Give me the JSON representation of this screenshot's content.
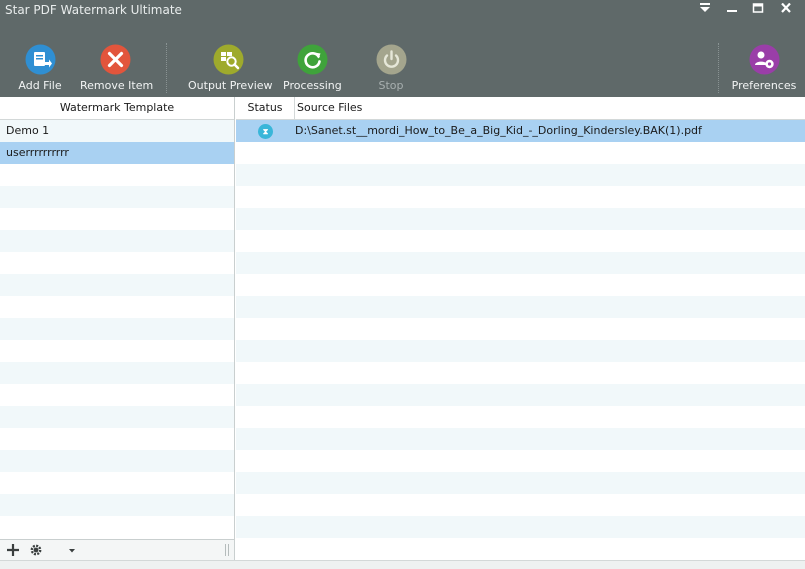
{
  "window": {
    "title": "Star PDF Watermark Ultimate"
  },
  "toolbar": {
    "add_file": "Add File",
    "remove_item": "Remove Item",
    "output_preview": "Output Preview",
    "processing": "Processing",
    "stop": "Stop",
    "preferences": "Preferences"
  },
  "templates": {
    "header": "Watermark Template",
    "items": [
      "Demo 1",
      "userrrrrrrrrr"
    ],
    "selected_index": 1
  },
  "files": {
    "status_header": "Status",
    "source_header": "Source Files",
    "items": [
      {
        "path": "D:\\Sanet.st__mordi_How_to_Be_a_Big_Kid_-_Dorling_Kindersley.BAK(1).pdf"
      }
    ]
  },
  "colors": {
    "chrome": "#5f6969",
    "selection": "#a9d1f2",
    "alt_row": "#f1f8fa",
    "add_icon": "#2f8fd3",
    "remove_icon": "#e2553c",
    "preview_icon": "#9eaa2c",
    "processing_icon": "#3fa33b",
    "stop_icon": "#a4a58d",
    "preferences_icon": "#9a3ea8"
  }
}
